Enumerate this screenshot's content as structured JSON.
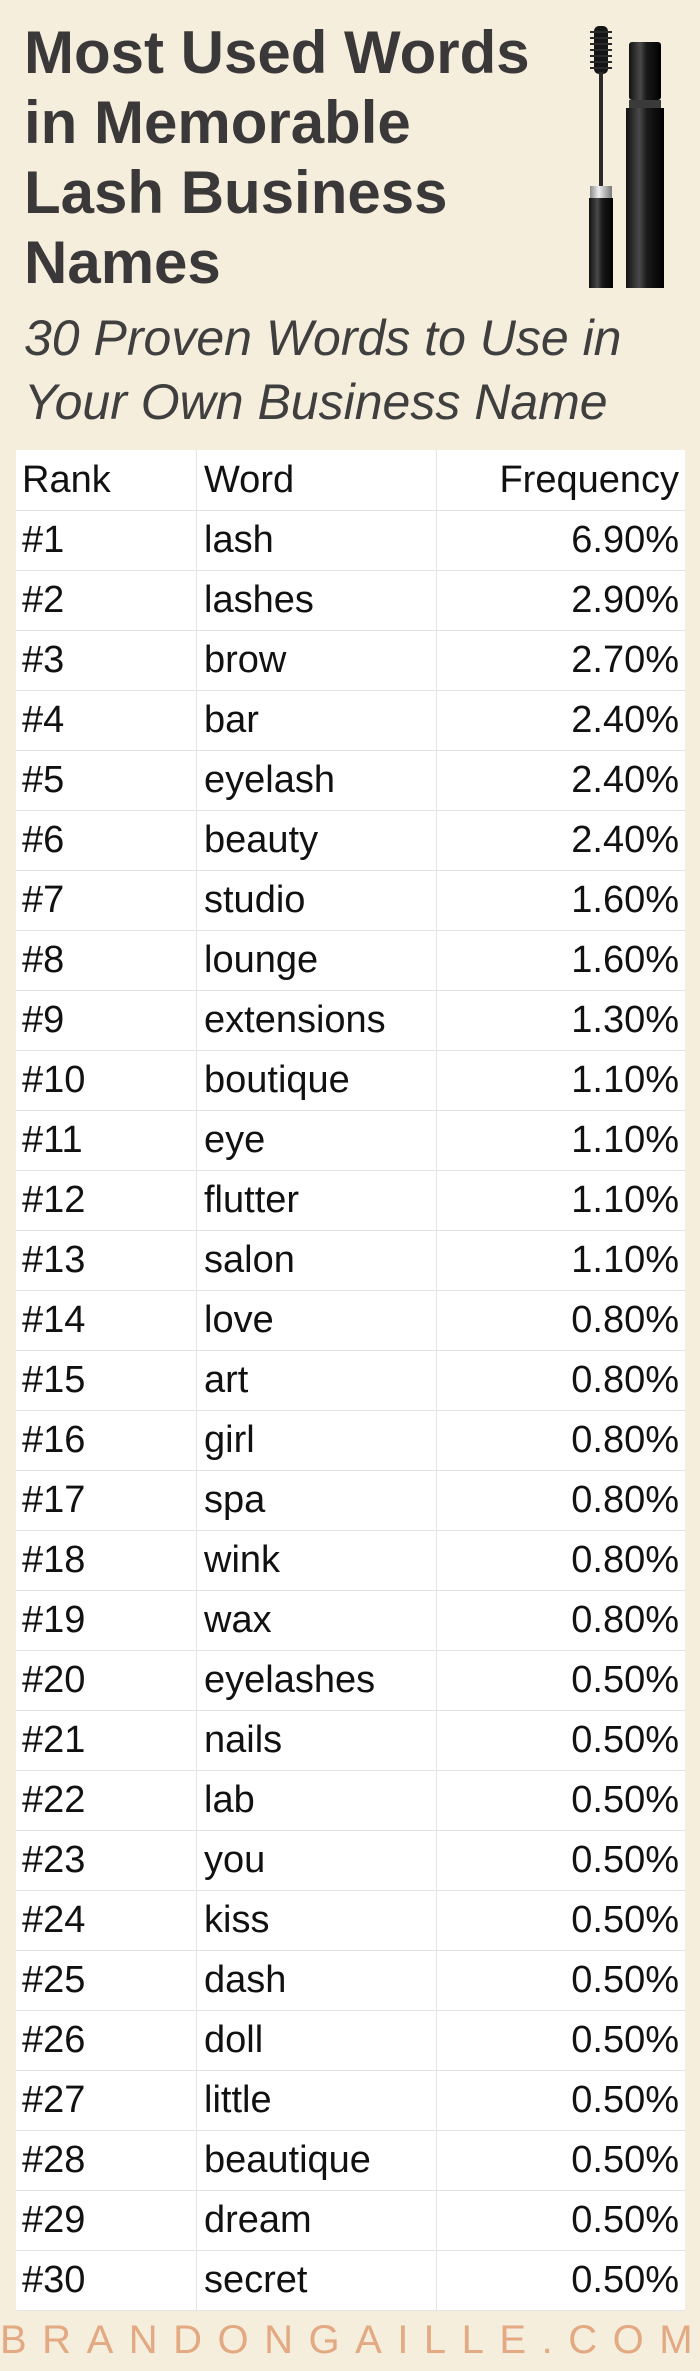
{
  "header": {
    "title": "Most Used Words in Memorable Lash Business Names",
    "subtitle": "30 Proven Words to Use in Your Own Business Name",
    "illustration_icon": "mascara-wand-icon"
  },
  "footer": {
    "brand": "BRANDONGAILLE.COM"
  },
  "colors": {
    "background": "#f6eedd",
    "title": "#3a3838",
    "brand": "#e2a982",
    "grid": "#e3e3e3"
  },
  "chart_data": {
    "type": "table",
    "title": "Most Used Words in Memorable Lash Business Names",
    "subtitle": "30 Proven Words to Use in Your Own Business Name",
    "columns": [
      "Rank",
      "Word",
      "Frequency"
    ],
    "rows": [
      [
        "#1",
        "lash",
        "6.90%"
      ],
      [
        "#2",
        "lashes",
        "2.90%"
      ],
      [
        "#3",
        "brow",
        "2.70%"
      ],
      [
        "#4",
        "bar",
        "2.40%"
      ],
      [
        "#5",
        "eyelash",
        "2.40%"
      ],
      [
        "#6",
        "beauty",
        "2.40%"
      ],
      [
        "#7",
        "studio",
        "1.60%"
      ],
      [
        "#8",
        "lounge",
        "1.60%"
      ],
      [
        "#9",
        "extensions",
        "1.30%"
      ],
      [
        "#10",
        "boutique",
        "1.10%"
      ],
      [
        "#11",
        "eye",
        "1.10%"
      ],
      [
        "#12",
        "flutter",
        "1.10%"
      ],
      [
        "#13",
        "salon",
        "1.10%"
      ],
      [
        "#14",
        "love",
        "0.80%"
      ],
      [
        "#15",
        "art",
        "0.80%"
      ],
      [
        "#16",
        "girl",
        "0.80%"
      ],
      [
        "#17",
        "spa",
        "0.80%"
      ],
      [
        "#18",
        "wink",
        "0.80%"
      ],
      [
        "#19",
        "wax",
        "0.80%"
      ],
      [
        "#20",
        "eyelashes",
        "0.50%"
      ],
      [
        "#21",
        "nails",
        "0.50%"
      ],
      [
        "#22",
        "lab",
        "0.50%"
      ],
      [
        "#23",
        "you",
        "0.50%"
      ],
      [
        "#24",
        "kiss",
        "0.50%"
      ],
      [
        "#25",
        "dash",
        "0.50%"
      ],
      [
        "#26",
        "doll",
        "0.50%"
      ],
      [
        "#27",
        "little",
        "0.50%"
      ],
      [
        "#28",
        "beautique",
        "0.50%"
      ],
      [
        "#29",
        "dream",
        "0.50%"
      ],
      [
        "#30",
        "secret",
        "0.50%"
      ]
    ]
  }
}
